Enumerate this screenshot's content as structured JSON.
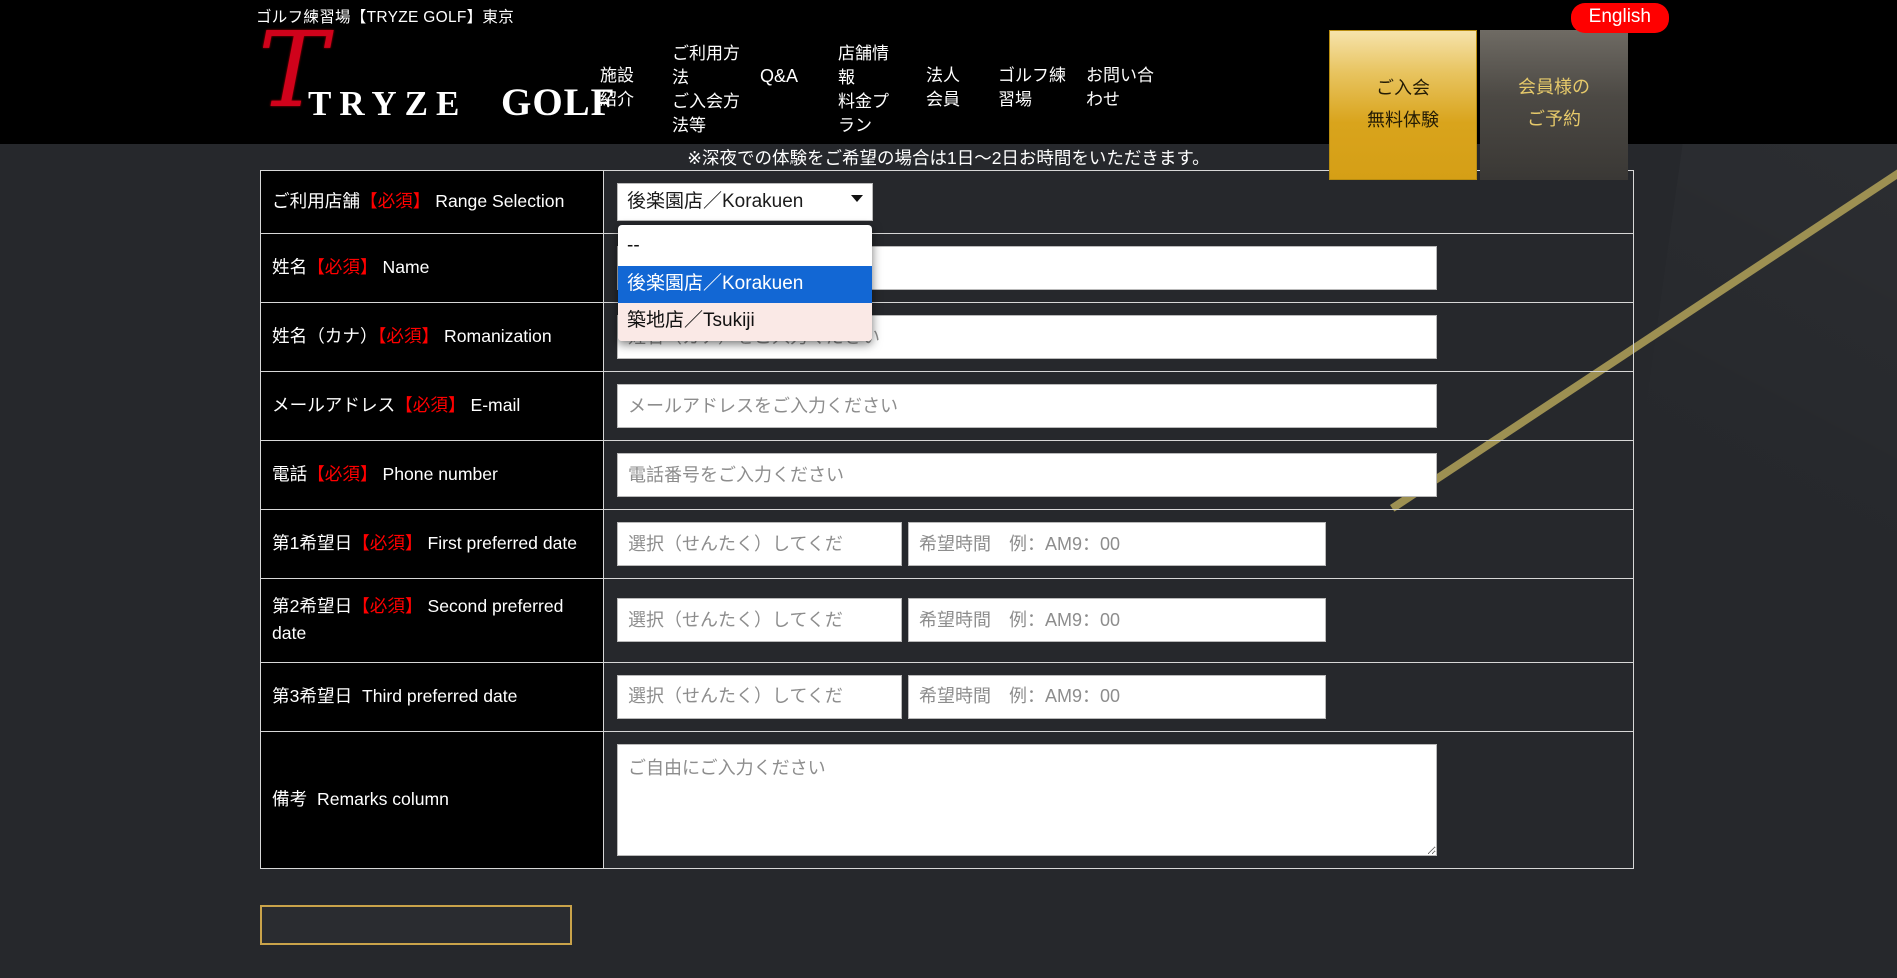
{
  "header": {
    "tagline": "ゴルフ練習場【TRYZE GOLF】東京",
    "english_badge": "English",
    "logo": {
      "script_mark": "T",
      "wordmark": "TRYZE",
      "suffix": "GOLF"
    },
    "nav": [
      {
        "label": "施設紹介",
        "lines": [
          "施設",
          "紹介"
        ]
      },
      {
        "label": "ご利用方法ご入会方法等",
        "lines": [
          "ご利用方",
          "法",
          "ご入会方",
          "法等"
        ]
      },
      {
        "label": "Q&A",
        "lines": [
          "Q&A"
        ]
      },
      {
        "label": "店舗情報料金プラン",
        "lines": [
          "店舗情",
          "報",
          "料金プ",
          "ラン"
        ]
      },
      {
        "label": "法人会員",
        "lines": [
          "法人",
          "会員"
        ]
      },
      {
        "label": "ゴルフ練習場",
        "lines": [
          "ゴルフ練",
          "習場"
        ]
      },
      {
        "label": "お問い合わせ",
        "lines": [
          "お問い合",
          "わせ"
        ]
      }
    ],
    "cta_primary": {
      "line1": "ご入会",
      "line2": "無料体験",
      "color": "#d9a41c"
    },
    "cta_secondary": {
      "line1": "会員様の",
      "line2": "ご予約",
      "color": "#e6c96a"
    }
  },
  "notice": "※深夜での体験をご希望の場合は1日〜2日お時間をいただきます。",
  "form": {
    "rows": [
      {
        "label_jp": "ご利用店舗",
        "required": "【必須】",
        "label_en": "Range Selection",
        "control": "select"
      },
      {
        "label_jp": "姓名",
        "required": "【必須】",
        "label_en": "Name",
        "control": "text",
        "placeholder": "",
        "value": ""
      },
      {
        "label_jp": "姓名（カナ）",
        "required": "【必須】",
        "label_en": "Romanization",
        "control": "text",
        "placeholder": "姓名（カナ）をご入力ください",
        "value": ""
      },
      {
        "label_jp": "メールアドレス",
        "required": "【必須】",
        "label_en": "E-mail",
        "control": "text",
        "placeholder": "メールアドレスをご入力ください",
        "value": ""
      },
      {
        "label_jp": "電話",
        "required": "【必須】",
        "label_en": "Phone number",
        "control": "text",
        "placeholder": "電話番号をご入力ください",
        "value": ""
      },
      {
        "label_jp": "第1希望日",
        "required": "【必須】",
        "label_en": "First preferred date",
        "control": "datetime",
        "date_placeholder": "選択（せんたく）してくだ",
        "time_placeholder": "希望時間　例：AM9：00"
      },
      {
        "label_jp": "第2希望日",
        "required": "【必須】",
        "label_en": "Second preferred date",
        "control": "datetime",
        "date_placeholder": "選択（せんたく）してくだ",
        "time_placeholder": "希望時間　例：AM9：00"
      },
      {
        "label_jp": "第3希望日",
        "required": "",
        "label_en": "Third preferred date",
        "control": "datetime",
        "date_placeholder": "選択（せんたく）してくだ",
        "time_placeholder": "希望時間　例：AM9：00"
      },
      {
        "label_jp": "備考",
        "required": "",
        "label_en": "Remarks column",
        "control": "textarea",
        "placeholder": "ご自由にご入力ください",
        "value": ""
      }
    ]
  },
  "range_select": {
    "selected_value": "後楽園店／Korakuen",
    "expanded": true,
    "options": [
      {
        "label": "--",
        "state": "normal"
      },
      {
        "label": "後楽園店／Korakuen",
        "state": "selected"
      },
      {
        "label": "築地店／Tsukiji",
        "state": "hover"
      }
    ],
    "highlight_color": "#1267d4",
    "hover_color": "#fae9e6"
  },
  "decor": {
    "gold_line_color": "#9d9052",
    "gold_border_color": "#c9a34a"
  }
}
